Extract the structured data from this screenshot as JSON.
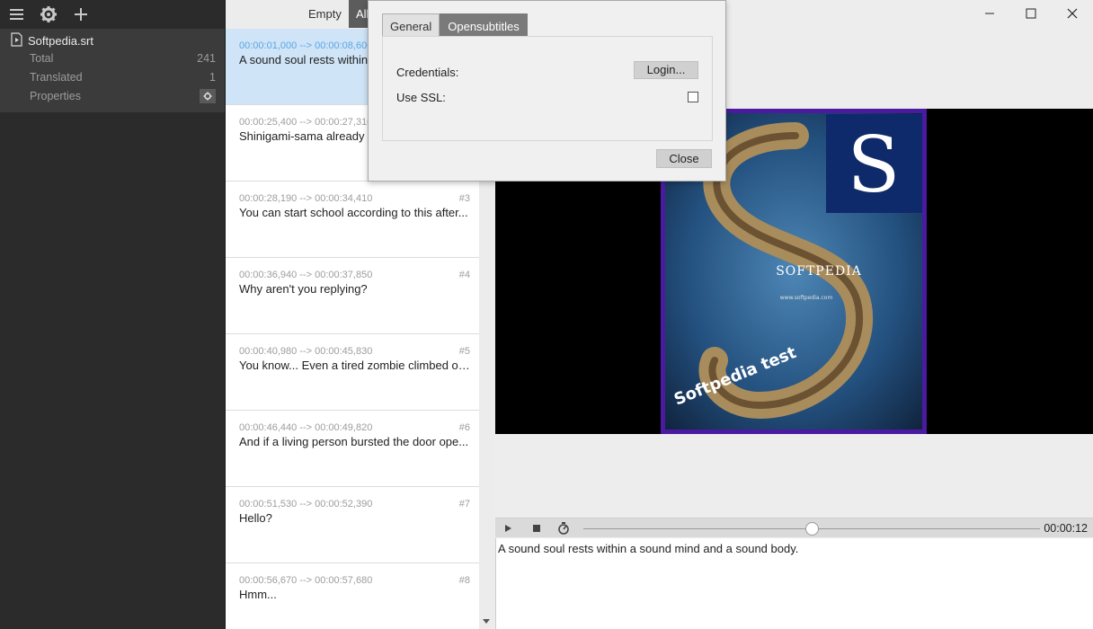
{
  "sidebar": {
    "file_name": "Softpedia.srt",
    "stats": [
      {
        "label": "Total",
        "value": "241"
      },
      {
        "label": "Translated",
        "value": "1"
      },
      {
        "label": "Properties",
        "value": ""
      }
    ]
  },
  "filters": {
    "empty_label": "Empty",
    "all_label": "All"
  },
  "subtitles": [
    {
      "time": "00:00:01,000 --> 00:00:08,600",
      "num": "",
      "text": "A sound soul rests within"
    },
    {
      "time": "00:00:25,400 --> 00:00:27,310",
      "num": "",
      "text": "Shinigami-sama already a"
    },
    {
      "time": "00:00:28,190 --> 00:00:34,410",
      "num": "#3",
      "text": "You can start school according to this after..."
    },
    {
      "time": "00:00:36,940 --> 00:00:37,850",
      "num": "#4",
      "text": "Why aren't you replying?"
    },
    {
      "time": "00:00:40,980 --> 00:00:45,830",
      "num": "#5",
      "text": "You know... Even a tired zombie climbed ou..."
    },
    {
      "time": "00:00:46,440 --> 00:00:49,820",
      "num": "#6",
      "text": "And if a living person bursted the door ope..."
    },
    {
      "time": "00:00:51,530 --> 00:00:52,390",
      "num": "#7",
      "text": "Hello?"
    },
    {
      "time": "00:00:56,670 --> 00:00:57,680",
      "num": "#8",
      "text": "Hmm..."
    }
  ],
  "dialog": {
    "tabs": [
      "General",
      "Opensubtitles"
    ],
    "active_tab": "Opensubtitles",
    "credentials_label": "Credentials:",
    "login_label": "Login...",
    "ssl_label": "Use SSL:",
    "ssl_checked": false,
    "close_label": "Close"
  },
  "video": {
    "title_text": "SOFTPEDIA",
    "url_text": "www.softpedia.com",
    "overlay_text": "Softpedia test",
    "logo_letter": "S"
  },
  "player": {
    "time": "00:00:12",
    "progress": 0.5
  },
  "editor": {
    "text": "A sound soul rests within a sound mind and a sound body."
  },
  "icons": {
    "menu": "menu-icon",
    "settings": "gear-icon",
    "add": "plus-icon",
    "file": "file-play-icon"
  },
  "colors": {
    "selected_row": "#cfe4f7",
    "selected_time": "#5aa7e4",
    "sidebar_bg": "#2b2b2b",
    "video_border": "#4a1aa0"
  }
}
